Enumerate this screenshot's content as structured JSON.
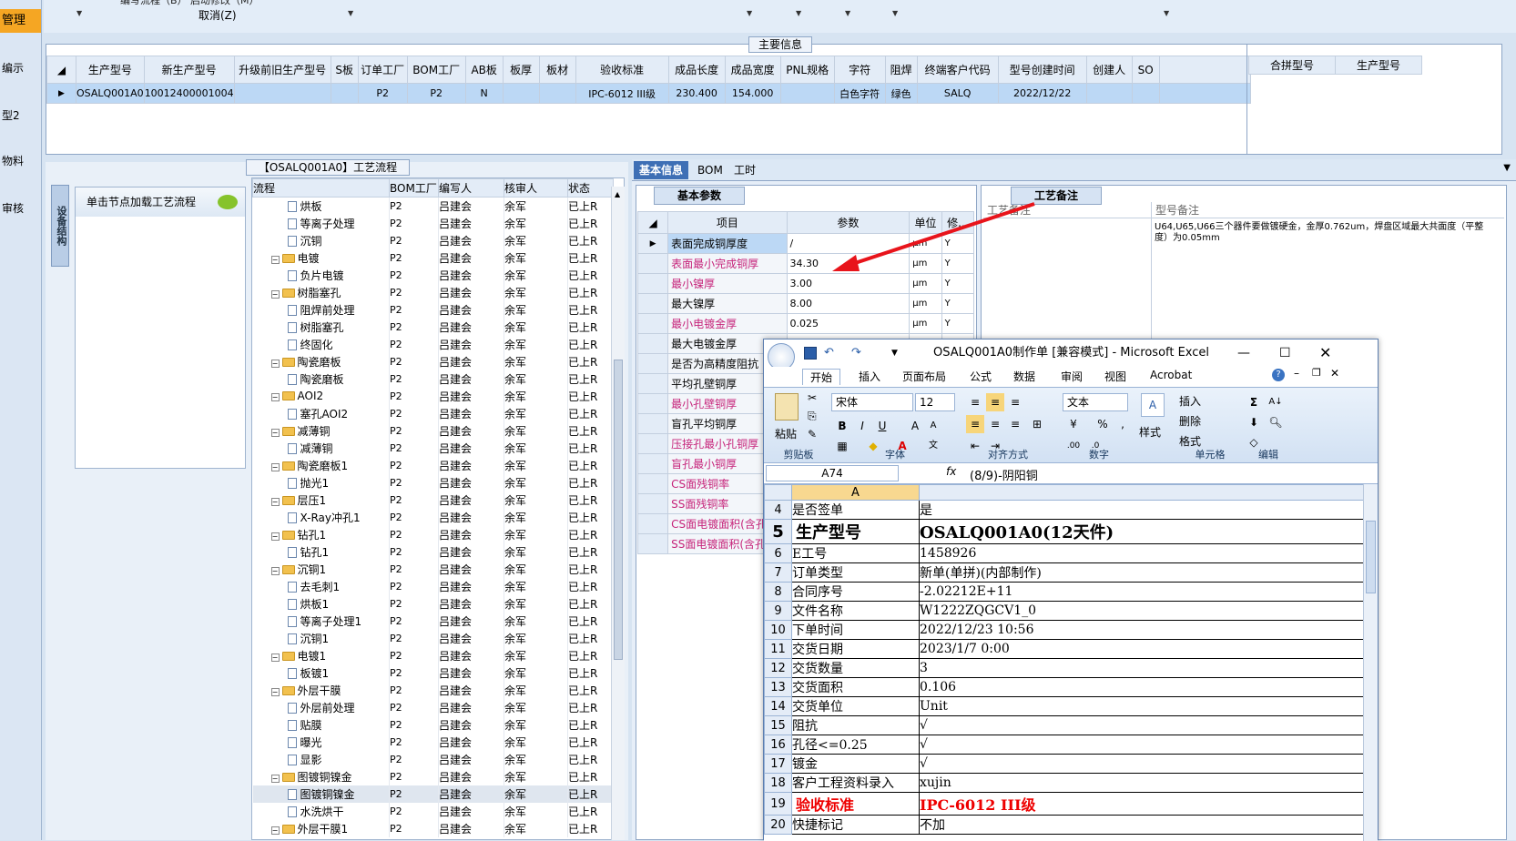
{
  "leftnav": {
    "items": [
      "管理",
      "编示",
      "",
      "型2",
      "",
      "物料",
      "",
      "审核"
    ]
  },
  "topstrip": {
    "line1": "编写流程（B）   启动修改（M）",
    "line2": "取消(Z)"
  },
  "main": {
    "title": "主要信息",
    "headers": [
      "生产型号",
      "新生产型号",
      "升级前旧生产型号",
      "S板",
      "订单工厂",
      "BOM工厂",
      "AB板",
      "板厚",
      "板材",
      "验收标准",
      "成品长度",
      "成品宽度",
      "PNL规格",
      "字符",
      "阻焊",
      "终端客户代码",
      "型号创建时间",
      "创建人",
      "SO"
    ],
    "row": [
      "OSALQ001A0",
      "10012400001004",
      "",
      "",
      "P2",
      "P2",
      "N",
      "",
      "",
      "IPC-6012 III级",
      "230.400",
      "154.000",
      "",
      "白色字符",
      "绿色",
      "SALQ",
      "2022/12/22",
      "",
      ""
    ],
    "side_headers": [
      "合拼型号",
      "生产型号"
    ]
  },
  "tree": {
    "title": "【OSALQ001A0】工艺流程",
    "equip_tab": "设备结构",
    "node_hint": "单击节点加载工艺流程",
    "headers": [
      "流程",
      "BOM工厂",
      "编写人",
      "核审人",
      "状态"
    ],
    "rows": [
      {
        "label": "烘板",
        "level": 2,
        "bom": "P2",
        "writer": "吕建会",
        "reviewer": "余军",
        "status": "已上R"
      },
      {
        "label": "等离子处理",
        "level": 2,
        "bom": "P2",
        "writer": "吕建会",
        "reviewer": "余军",
        "status": "已上R"
      },
      {
        "label": "沉铜",
        "level": 2,
        "bom": "P2",
        "writer": "吕建会",
        "reviewer": "余军",
        "status": "已上R"
      },
      {
        "label": "电镀",
        "level": 1,
        "bom": "P2",
        "writer": "吕建会",
        "reviewer": "余军",
        "status": "已上R"
      },
      {
        "label": "负片电镀",
        "level": 2,
        "bom": "P2",
        "writer": "吕建会",
        "reviewer": "余军",
        "status": "已上R"
      },
      {
        "label": "树脂塞孔",
        "level": 1,
        "bom": "P2",
        "writer": "吕建会",
        "reviewer": "余军",
        "status": "已上R"
      },
      {
        "label": "阻焊前处理",
        "level": 2,
        "bom": "P2",
        "writer": "吕建会",
        "reviewer": "余军",
        "status": "已上R"
      },
      {
        "label": "树脂塞孔",
        "level": 2,
        "bom": "P2",
        "writer": "吕建会",
        "reviewer": "余军",
        "status": "已上R"
      },
      {
        "label": "终固化",
        "level": 2,
        "bom": "P2",
        "writer": "吕建会",
        "reviewer": "余军",
        "status": "已上R"
      },
      {
        "label": "陶瓷磨板",
        "level": 1,
        "bom": "P2",
        "writer": "吕建会",
        "reviewer": "余军",
        "status": "已上R"
      },
      {
        "label": "陶瓷磨板",
        "level": 2,
        "bom": "P2",
        "writer": "吕建会",
        "reviewer": "余军",
        "status": "已上R"
      },
      {
        "label": "AOI2",
        "level": 1,
        "bom": "P2",
        "writer": "吕建会",
        "reviewer": "余军",
        "status": "已上R"
      },
      {
        "label": "塞孔AOI2",
        "level": 2,
        "bom": "P2",
        "writer": "吕建会",
        "reviewer": "余军",
        "status": "已上R"
      },
      {
        "label": "减薄铜",
        "level": 1,
        "bom": "P2",
        "writer": "吕建会",
        "reviewer": "余军",
        "status": "已上R"
      },
      {
        "label": "减薄铜",
        "level": 2,
        "bom": "P2",
        "writer": "吕建会",
        "reviewer": "余军",
        "status": "已上R"
      },
      {
        "label": "陶瓷磨板1",
        "level": 1,
        "bom": "P2",
        "writer": "吕建会",
        "reviewer": "余军",
        "status": "已上R"
      },
      {
        "label": "抛光1",
        "level": 2,
        "bom": "P2",
        "writer": "吕建会",
        "reviewer": "余军",
        "status": "已上R"
      },
      {
        "label": "层压1",
        "level": 1,
        "bom": "P2",
        "writer": "吕建会",
        "reviewer": "余军",
        "status": "已上R"
      },
      {
        "label": "X-Ray冲孔1",
        "level": 2,
        "bom": "P2",
        "writer": "吕建会",
        "reviewer": "余军",
        "status": "已上R"
      },
      {
        "label": "钻孔1",
        "level": 1,
        "bom": "P2",
        "writer": "吕建会",
        "reviewer": "余军",
        "status": "已上R"
      },
      {
        "label": "钻孔1",
        "level": 2,
        "bom": "P2",
        "writer": "吕建会",
        "reviewer": "余军",
        "status": "已上R"
      },
      {
        "label": "沉铜1",
        "level": 1,
        "bom": "P2",
        "writer": "吕建会",
        "reviewer": "余军",
        "status": "已上R"
      },
      {
        "label": "去毛刺1",
        "level": 2,
        "bom": "P2",
        "writer": "吕建会",
        "reviewer": "余军",
        "status": "已上R"
      },
      {
        "label": "烘板1",
        "level": 2,
        "bom": "P2",
        "writer": "吕建会",
        "reviewer": "余军",
        "status": "已上R"
      },
      {
        "label": "等离子处理1",
        "level": 2,
        "bom": "P2",
        "writer": "吕建会",
        "reviewer": "余军",
        "status": "已上R"
      },
      {
        "label": "沉铜1",
        "level": 2,
        "bom": "P2",
        "writer": "吕建会",
        "reviewer": "余军",
        "status": "已上R"
      },
      {
        "label": "电镀1",
        "level": 1,
        "bom": "P2",
        "writer": "吕建会",
        "reviewer": "余军",
        "status": "已上R"
      },
      {
        "label": "板镀1",
        "level": 2,
        "bom": "P2",
        "writer": "吕建会",
        "reviewer": "余军",
        "status": "已上R"
      },
      {
        "label": "外层干膜",
        "level": 1,
        "bom": "P2",
        "writer": "吕建会",
        "reviewer": "余军",
        "status": "已上R"
      },
      {
        "label": "外层前处理",
        "level": 2,
        "bom": "P2",
        "writer": "吕建会",
        "reviewer": "余军",
        "status": "已上R"
      },
      {
        "label": "贴膜",
        "level": 2,
        "bom": "P2",
        "writer": "吕建会",
        "reviewer": "余军",
        "status": "已上R"
      },
      {
        "label": "曝光",
        "level": 2,
        "bom": "P2",
        "writer": "吕建会",
        "reviewer": "余军",
        "status": "已上R"
      },
      {
        "label": "显影",
        "level": 2,
        "bom": "P2",
        "writer": "吕建会",
        "reviewer": "余军",
        "status": "已上R"
      },
      {
        "label": "图镀铜镍金",
        "level": 1,
        "bom": "P2",
        "writer": "吕建会",
        "reviewer": "余军",
        "status": "已上R"
      },
      {
        "label": "图镀铜镍金",
        "level": 2,
        "bom": "P2",
        "writer": "吕建会",
        "reviewer": "余军",
        "status": "已上R",
        "selected": true
      },
      {
        "label": "水洗烘干",
        "level": 2,
        "bom": "P2",
        "writer": "吕建会",
        "reviewer": "余军",
        "status": "已上R"
      },
      {
        "label": "外层干膜1",
        "level": 1,
        "bom": "P2",
        "writer": "吕建会",
        "reviewer": "余军",
        "status": "已上R"
      }
    ]
  },
  "detail": {
    "tabs": [
      "基本信息",
      "BOM",
      "工时"
    ],
    "basic_title": "基本参数",
    "param_headers": [
      "项目",
      "参数",
      "单位",
      "修..."
    ],
    "params": [
      {
        "item": "表面完成铜厚度",
        "value": "/",
        "unit": "μm",
        "flag": "Y",
        "pink": false
      },
      {
        "item": "表面最小完成铜厚",
        "value": "34.30",
        "unit": "μm",
        "flag": "Y",
        "pink": true
      },
      {
        "item": "最小镍厚",
        "value": "3.00",
        "unit": "μm",
        "flag": "Y",
        "pink": true
      },
      {
        "item": "最大镍厚",
        "value": "8.00",
        "unit": "μm",
        "flag": "Y",
        "pink": false
      },
      {
        "item": "最小电镀金厚",
        "value": "0.025",
        "unit": "μm",
        "flag": "Y",
        "pink": true
      },
      {
        "item": "最大电镀金厚",
        "value": "",
        "unit": "",
        "flag": "",
        "pink": false
      },
      {
        "item": "是否为高精度阻抗",
        "value": "",
        "unit": "",
        "flag": "",
        "pink": false
      },
      {
        "item": "平均孔壁铜厚",
        "value": "",
        "unit": "",
        "flag": "",
        "pink": false
      },
      {
        "item": "最小孔壁铜厚",
        "value": "",
        "unit": "",
        "flag": "",
        "pink": true
      },
      {
        "item": "盲孔平均铜厚",
        "value": "",
        "unit": "",
        "flag": "",
        "pink": false
      },
      {
        "item": "压接孔最小孔铜厚",
        "value": "",
        "unit": "",
        "flag": "",
        "pink": true
      },
      {
        "item": "盲孔最小铜厚",
        "value": "",
        "unit": "",
        "flag": "",
        "pink": true
      },
      {
        "item": "CS面残铜率",
        "value": "",
        "unit": "",
        "flag": "",
        "pink": true
      },
      {
        "item": "SS面残铜率",
        "value": "",
        "unit": "",
        "flag": "",
        "pink": true
      },
      {
        "item": "CS面电镀面积(含孔",
        "value": "",
        "unit": "",
        "flag": "",
        "pink": true
      },
      {
        "item": "SS面电镀面积(含孔",
        "value": "",
        "unit": "",
        "flag": "",
        "pink": true
      }
    ],
    "remark_title": "工艺备注",
    "remark_headers": [
      "工艺备注",
      "型号备注"
    ],
    "model_remark": "U64,U65,U66三个器件要做镀硬金，金厚0.762um，焊盘区域最大共面度（平整度）为0.05mm"
  },
  "excel": {
    "title": "OSALQ001A0制作单 [兼容模式] - Microsoft Excel",
    "tabs": [
      "开始",
      "插入",
      "页面布局",
      "公式",
      "数据",
      "审阅",
      "视图",
      "Acrobat"
    ],
    "font_name": "宋体",
    "font_size": "12",
    "number_format": "文本",
    "group_labels": [
      "剪贴板",
      "字体",
      "对齐方式",
      "数字",
      "样式",
      "单元格",
      "编辑"
    ],
    "paste_label": "粘贴",
    "style_label": "样式",
    "cell_buttons": [
      "插入",
      "删除",
      "格式"
    ],
    "name_box": "A74",
    "formula": "(8/9)-阴阳铜",
    "col_header": "A",
    "rows": [
      {
        "n": "4",
        "a": "是否签单",
        "b": "是"
      },
      {
        "n": "5",
        "a": "生产型号",
        "b": "OSALQ001A0(12天件)",
        "big": true
      },
      {
        "n": "6",
        "a": "E工号",
        "b": "1458926"
      },
      {
        "n": "7",
        "a": "订单类型",
        "b": "新单(单拼)(内部制作)"
      },
      {
        "n": "8",
        "a": "合同序号",
        "b": "-2.02212E+11"
      },
      {
        "n": "9",
        "a": "文件名称",
        "b": "W1222ZQGCV1_0"
      },
      {
        "n": "10",
        "a": "下单时间",
        "b": "2022/12/23 10:56"
      },
      {
        "n": "11",
        "a": "交货日期",
        "b": "2023/1/7 0:00"
      },
      {
        "n": "12",
        "a": "交货数量",
        "b": "3"
      },
      {
        "n": "13",
        "a": "交货面积",
        "b": "0.106"
      },
      {
        "n": "14",
        "a": "交货单位",
        "b": "Unit"
      },
      {
        "n": "15",
        "a": "阻抗",
        "b": "√"
      },
      {
        "n": "16",
        "a": "孔径<=0.25",
        "b": "√"
      },
      {
        "n": "17",
        "a": "镀金",
        "b": "√"
      },
      {
        "n": "18",
        "a": "客户工程资料录入",
        "b": "xujin"
      },
      {
        "n": "19",
        "a": "验收标准",
        "b": "IPC-6012 III级",
        "red": true
      },
      {
        "n": "20",
        "a": "快捷标记",
        "b": "不加"
      }
    ]
  }
}
